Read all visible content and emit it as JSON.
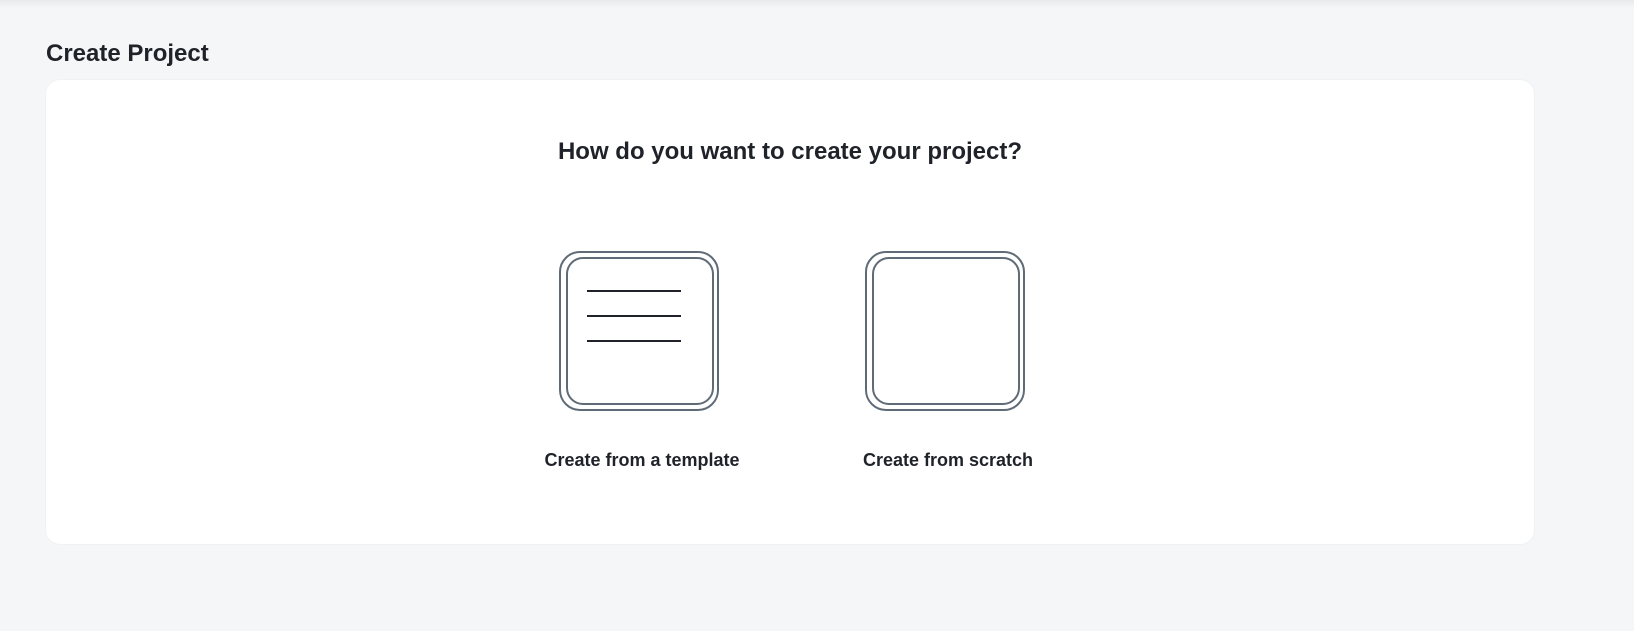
{
  "page": {
    "title": "Create Project"
  },
  "card": {
    "question": "How do you want to create your project?",
    "options": [
      {
        "label": "Create from a template",
        "icon": "template-document-icon"
      },
      {
        "label": "Create from scratch",
        "icon": "blank-document-icon"
      }
    ]
  },
  "colors": {
    "background": "#f5f6f8",
    "card": "#ffffff",
    "text": "#1f2329",
    "icon_stroke": "#5f6b77"
  }
}
